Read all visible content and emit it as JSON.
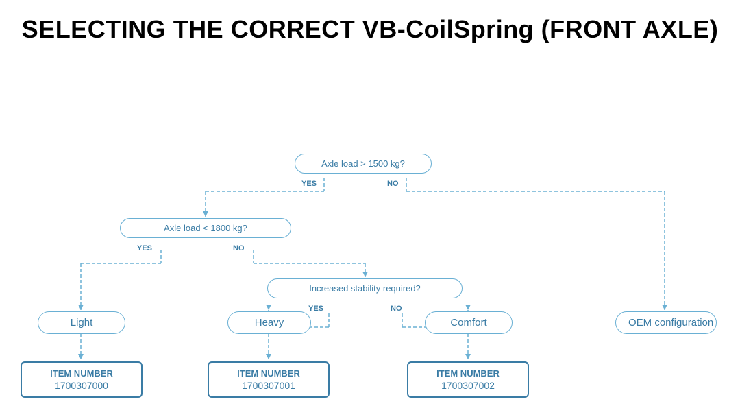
{
  "title": "SELECTING THE CORRECT VB-CoilSpring (FRONT AXLE)",
  "diagram": {
    "decision1": {
      "text": "Axle load > 1500 kg?",
      "yes": "YES",
      "no": "NO"
    },
    "decision2": {
      "text": "Axle load < 1800 kg?",
      "yes": "YES",
      "no": "NO"
    },
    "decision3": {
      "text": "Increased stability required?",
      "yes": "YES",
      "no": "NO"
    },
    "result_light": "Light",
    "result_heavy": "Heavy",
    "result_comfort": "Comfort",
    "result_oem": "OEM configuration",
    "item1_label": "ITEM NUMBER",
    "item1_number": "1700307000",
    "item2_label": "ITEM NUMBER",
    "item2_number": "1700307001",
    "item3_label": "ITEM NUMBER",
    "item3_number": "1700307002"
  }
}
